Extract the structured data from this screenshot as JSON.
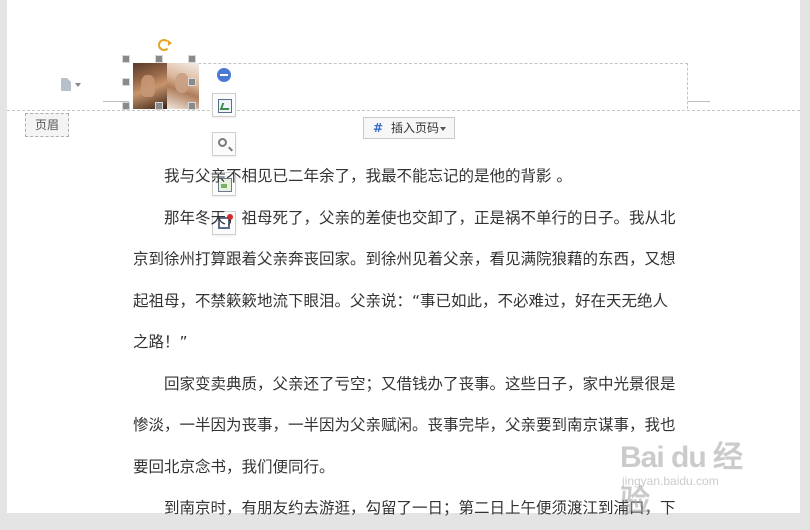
{
  "header": {
    "label": "页眉",
    "insert_page_number": "插入页码"
  },
  "icons": {
    "doc_menu": "document-icon",
    "rotate": "rotate-icon",
    "collapse": "collapse-icon",
    "layout_options": "layout-options-icon",
    "zoom": "zoom-in-icon",
    "crop": "crop-icon",
    "border": "picture-border-icon"
  },
  "body": {
    "paragraphs": [
      "我与父亲不相见已二年余了，我最不能忘记的是他的背影 。",
      "那年冬天，祖母死了，父亲的差使也交卸了，正是祸不单行的日子。我从北",
      "京到徐州打算跟着父亲奔丧回家。到徐州见着父亲，看见满院狼藉的东西，又想",
      "起祖母，不禁簌簌地流下眼泪。父亲说：“事已如此，不必难过，好在天无绝人",
      "之路！”",
      "回家变卖典质，父亲还了亏空；又借钱办了丧事。这些日子，家中光景很是",
      "惨淡，一半因为丧事，一半因为父亲赋闲。丧事完毕，父亲要到南京谋事，我也",
      "要回北京念书，我们便同行。",
      "到南京时，有朋友约去游逛，勾留了一日；第二日上午便须渡江到浦口，下"
    ]
  },
  "watermark": {
    "main": "Bai du 经验",
    "sub": "jingyan.baidu.com"
  }
}
